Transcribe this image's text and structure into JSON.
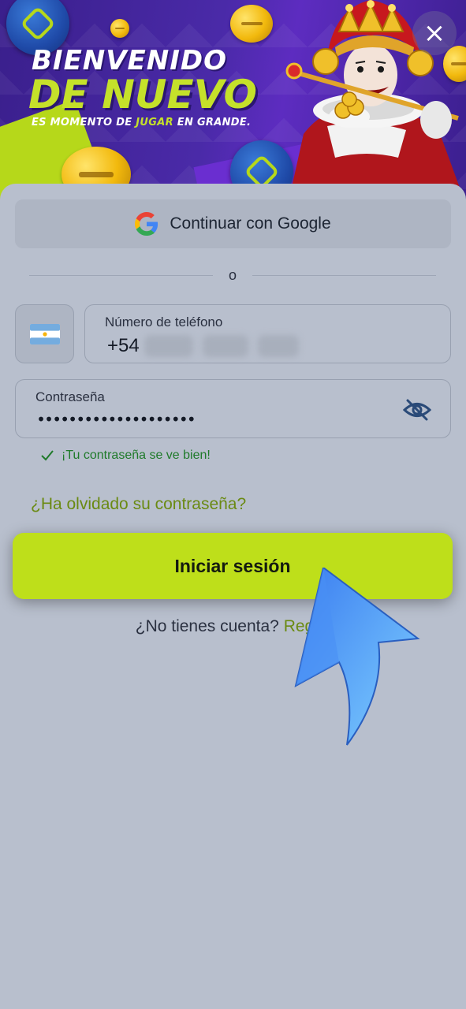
{
  "banner": {
    "line1": "BIENVENIDO",
    "line2": "DE NUEVO",
    "tagline_pre": "ES MOMENTO DE ",
    "tagline_highlight": "JUGAR",
    "tagline_post": " EN GRANDE."
  },
  "close_label": "×",
  "google": {
    "label": "Continuar con Google"
  },
  "divider_text": "o",
  "phone": {
    "label": "Número de teléfono",
    "prefix": "+54",
    "flag_icon": "argentina-flag-icon"
  },
  "password": {
    "label": "Contraseña",
    "value": "••••••••••••••••••••",
    "toggle_icon": "eye-off-icon",
    "status": "¡Tu contraseña se ve bien!"
  },
  "forgot_link": "¿Ha olvidado su contraseña?",
  "login_button": "Iniciar sesión",
  "register": {
    "prompt": "¿No tienes cuenta? ",
    "link": "Regist"
  },
  "colors": {
    "accent_lime": "#bedf1a",
    "link_green": "#6a8a12",
    "success_green": "#1f7a2a",
    "sheet_bg": "#b8bfcd"
  }
}
